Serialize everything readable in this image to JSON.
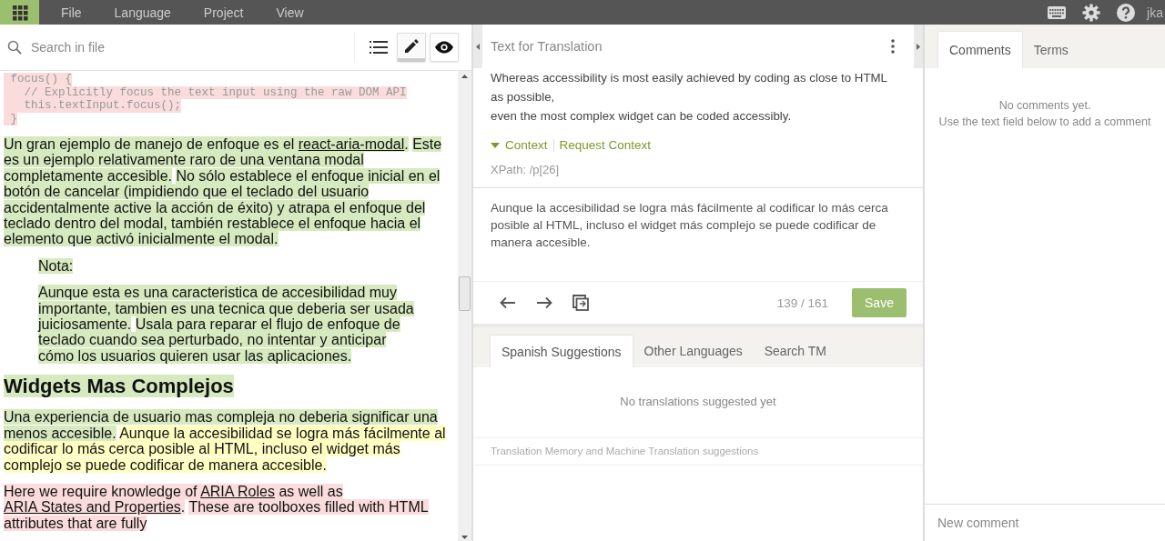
{
  "menu": {
    "items": [
      "File",
      "Language",
      "Project",
      "View"
    ],
    "user": "jka"
  },
  "editor": {
    "search": {
      "placeholder": "Search in file"
    },
    "view_modes": [
      {
        "kind": "list",
        "selected": false
      },
      {
        "kind": "edit",
        "selected": true
      },
      {
        "kind": "preview",
        "selected": false
      }
    ],
    "blocks": [
      {
        "kind": "code",
        "lines": [
          " focus() {",
          "   // Explicitly focus the text input using the raw DOM API",
          "   this.textInput.focus();",
          " }"
        ]
      },
      {
        "kind": "paragraph",
        "segments": [
          {
            "kind": "translated",
            "parts": [
              {
                "kind": "text",
                "text": "Un gran ejemplo de manejo de enfoque es el "
              },
              {
                "kind": "link",
                "text": "react-aria-modal"
              },
              {
                "kind": "text",
                "text": "."
              }
            ]
          },
          {
            "kind": "translated",
            "parts": [
              {
                "kind": "text",
                "text": "Este es un ejemplo relativamente raro de una ventana modal completamente accesible."
              }
            ]
          },
          {
            "kind": "translated",
            "parts": [
              {
                "kind": "text",
                "text": "No sólo establece el enfoque inicial en el botón de cancelar (impidiendo que el teclado del usuario accidentalmente active la acción de éxito) y atrapa el enfoque del teclado dentro del modal, también restablece el enfoque hacia el elemento que activó inicialmente el modal."
              }
            ]
          }
        ]
      },
      {
        "kind": "note",
        "segments": [
          {
            "kind": "translated",
            "parts": [
              {
                "kind": "text",
                "text": "Nota:"
              }
            ]
          }
        ]
      },
      {
        "kind": "note",
        "segments": [
          {
            "kind": "translated",
            "parts": [
              {
                "kind": "text",
                "text": "Aunque esta es una caracteristica de accesibilidad muy importante, tambien es una tecnica que deberia ser usada juiciosamente."
              }
            ]
          },
          {
            "kind": "translated",
            "parts": [
              {
                "kind": "text",
                "text": "Usala para reparar el flujo de enfoque de teclado cuando sea perturbado, no intentar y anticipar cómo los usuarios quieren usar las aplicaciones."
              }
            ]
          }
        ]
      },
      {
        "kind": "heading",
        "segments": [
          {
            "kind": "translated",
            "parts": [
              {
                "kind": "text",
                "text": "Widgets Mas Complejos"
              }
            ]
          }
        ]
      },
      {
        "kind": "paragraph",
        "segments": [
          {
            "kind": "translated",
            "parts": [
              {
                "kind": "text",
                "text": "Una experiencia de usuario mas compleja no deberia significar una menos accesible."
              }
            ]
          },
          {
            "kind": "current",
            "parts": [
              {
                "kind": "text",
                "text": "Aunque la accesibilidad se logra más fácilmente al codificar lo más cerca posible al HTML, incluso el widget más complejo se puede codificar de manera accesible."
              }
            ]
          }
        ]
      },
      {
        "kind": "paragraph",
        "segments": [
          {
            "kind": "untranslated",
            "parts": [
              {
                "kind": "text",
                "text": "Here we require knowledge of "
              },
              {
                "kind": "link",
                "text": "ARIA Roles"
              },
              {
                "kind": "text",
                "text": " as well as "
              },
              {
                "kind": "link",
                "text": "ARIA States and Properties"
              },
              {
                "kind": "text",
                "text": "."
              }
            ]
          },
          {
            "kind": "untranslated",
            "parts": [
              {
                "kind": "text",
                "text": "These are toolboxes filled with HTML attributes that are fully"
              }
            ]
          }
        ]
      }
    ]
  },
  "translation": {
    "title": "Text for Translation",
    "source_lines": [
      "Whereas accessibility is most easily achieved by coding as close to HTML as possible,",
      "even the most complex widget can be coded accessibly."
    ],
    "context": {
      "label": "Context",
      "expanded": true,
      "request": "Request Context",
      "xpath": "XPath: /p[26]"
    },
    "target": "Aunque la accesibilidad se logra más fácilmente al codificar lo más cerca posible al HTML, incluso el widget más complejo se puede codificar de manera accesible.",
    "counter": "139 / 161",
    "save": "Save",
    "tabs": [
      {
        "label": "Spanish Suggestions",
        "selected": true
      },
      {
        "label": "Other Languages",
        "selected": false
      },
      {
        "label": "Search TM",
        "selected": false
      }
    ],
    "empty": "No translations suggested yet",
    "footer": "Translation Memory and Machine Translation suggestions"
  },
  "sidebar": {
    "tabs": [
      {
        "label": "Comments",
        "selected": true
      },
      {
        "label": "Terms",
        "selected": false
      }
    ],
    "empty_lines": [
      "No comments yet.",
      "Use the text field below to add a comment"
    ],
    "new_comment": {
      "placeholder": "New comment"
    }
  }
}
